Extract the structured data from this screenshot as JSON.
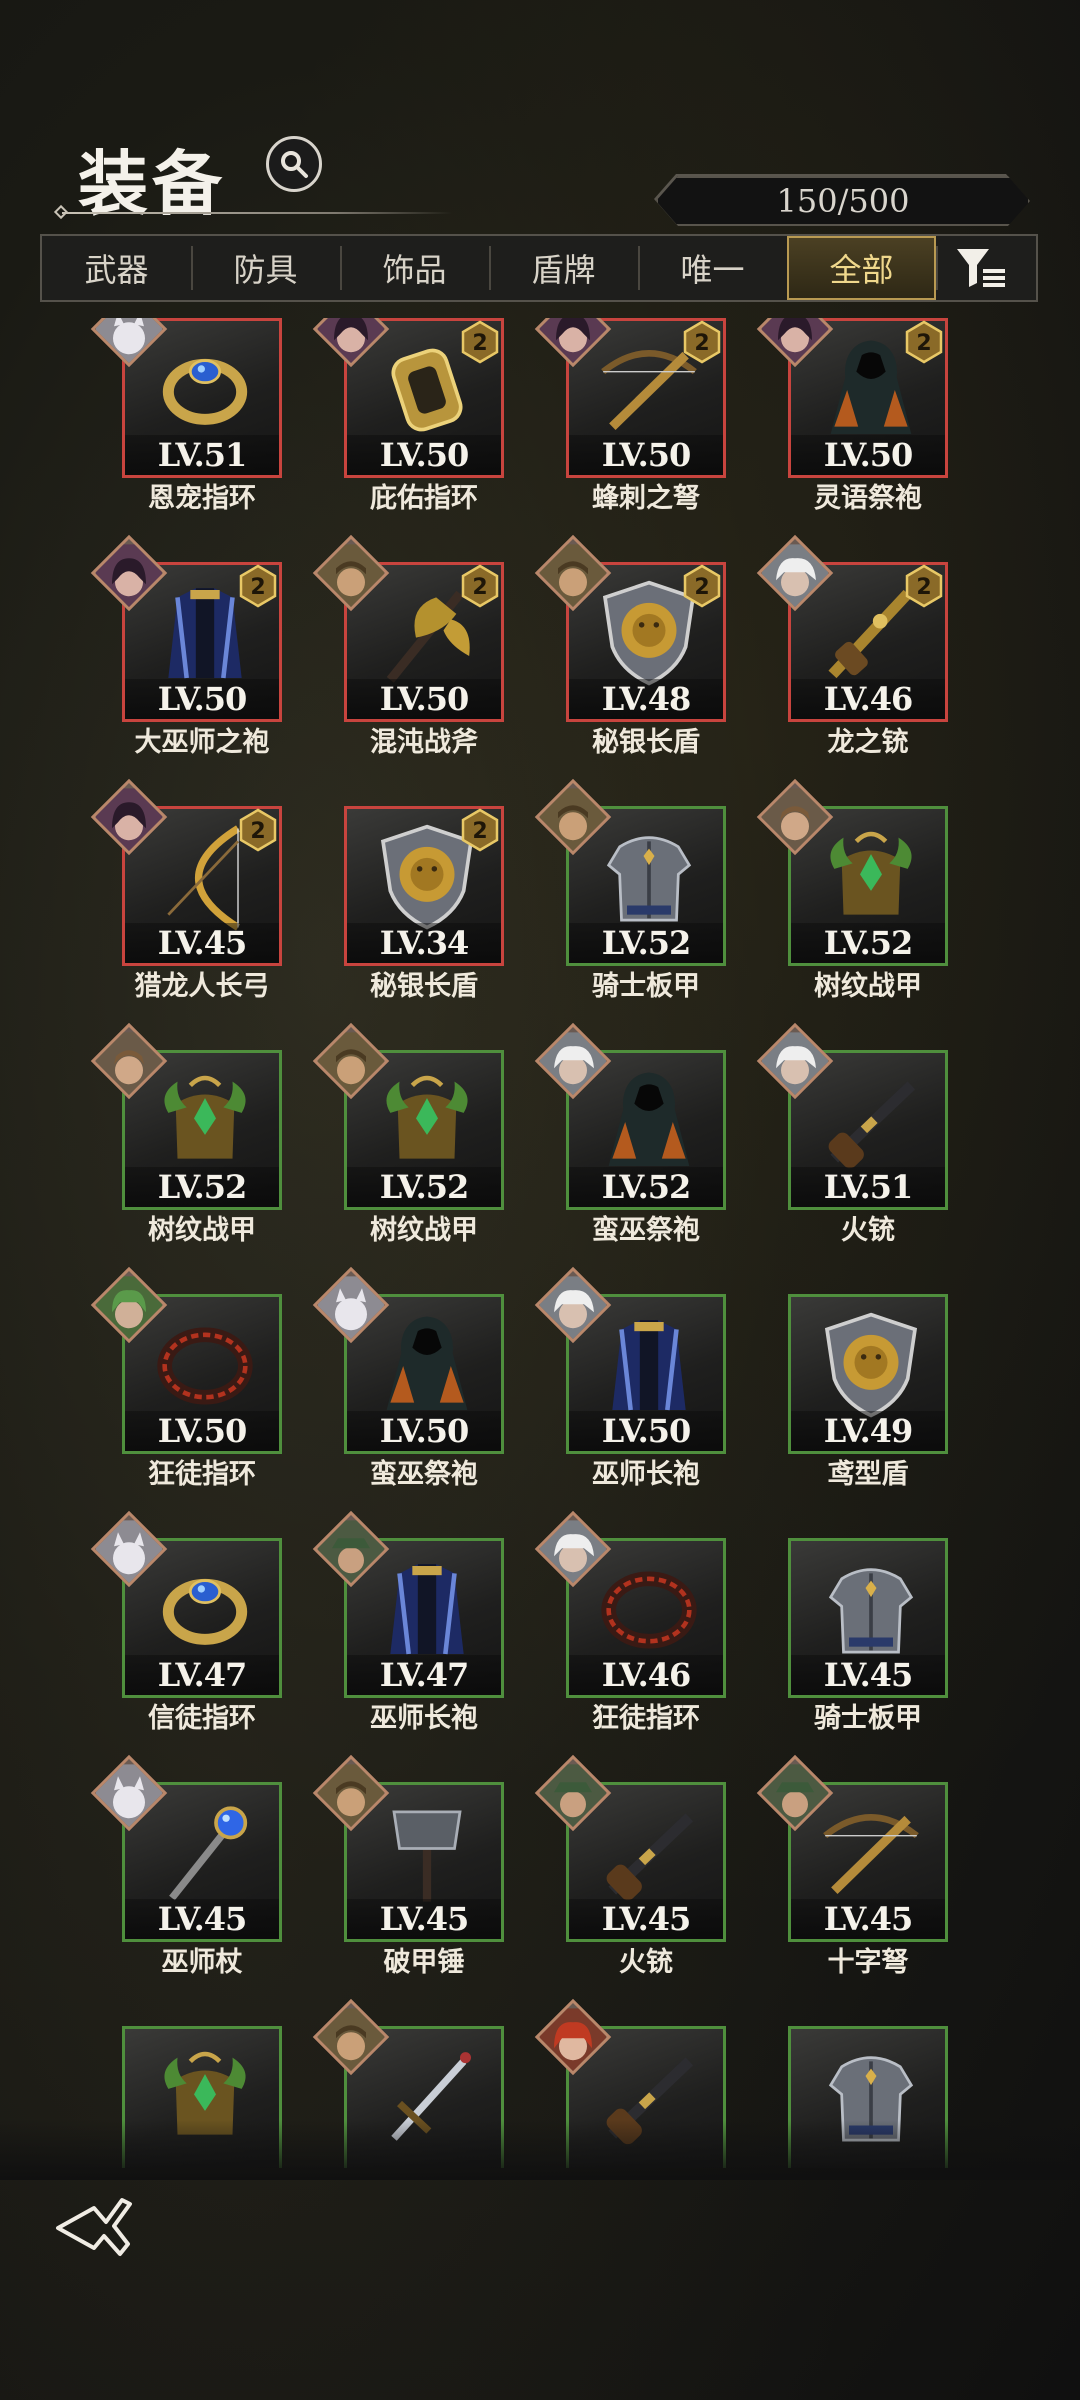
{
  "header": {
    "title": "装备",
    "counter": "150/500"
  },
  "tabs": [
    {
      "label": "武器"
    },
    {
      "label": "防具"
    },
    {
      "label": "饰品"
    },
    {
      "label": "盾牌"
    },
    {
      "label": "唯一"
    },
    {
      "label": "全部",
      "active": true
    }
  ],
  "colors": {
    "rare_border": "#c8443e",
    "uncommon_border": "#4f8f3d",
    "active_tab": "#b99a52"
  },
  "items": [
    {
      "name": "恩宠指环",
      "level": "LV.51",
      "rarity": "red",
      "icon": "ring-blue-gem-icon",
      "portrait": "white-cat-portrait"
    },
    {
      "name": "庇佑指环",
      "level": "LV.50",
      "rarity": "red",
      "icon": "gold-ring-icon",
      "badge": "2",
      "portrait": "dark-hair-woman-portrait"
    },
    {
      "name": "蜂刺之弩",
      "level": "LV.50",
      "rarity": "red",
      "icon": "crossbow-icon",
      "badge": "2",
      "portrait": "dark-hair-woman-portrait"
    },
    {
      "name": "灵语祭袍",
      "level": "LV.50",
      "rarity": "red",
      "icon": "hooded-robe-icon",
      "badge": "2",
      "portrait": "dark-hair-woman-portrait"
    },
    {
      "name": "大巫师之袍",
      "level": "LV.50",
      "rarity": "red",
      "icon": "blue-robe-icon",
      "badge": "2",
      "portrait": "dark-hair-woman-portrait"
    },
    {
      "name": "混沌战斧",
      "level": "LV.50",
      "rarity": "red",
      "icon": "battle-axe-icon",
      "badge": "2",
      "portrait": "warrior-portrait"
    },
    {
      "name": "秘银长盾",
      "level": "LV.48",
      "rarity": "red",
      "icon": "lion-shield-icon",
      "badge": "2",
      "portrait": "warrior-portrait"
    },
    {
      "name": "龙之铳",
      "level": "LV.46",
      "rarity": "red",
      "icon": "gold-gun-icon",
      "badge": "2",
      "portrait": "white-hair-portrait"
    },
    {
      "name": "猎龙人长弓",
      "level": "LV.45",
      "rarity": "red",
      "icon": "longbow-icon",
      "badge": "2",
      "portrait": "dark-hair-woman-portrait"
    },
    {
      "name": "秘银长盾",
      "level": "LV.34",
      "rarity": "red",
      "icon": "lion-shield-icon",
      "badge": "2",
      "portrait": null
    },
    {
      "name": "骑士板甲",
      "level": "LV.52",
      "rarity": "green",
      "icon": "plate-armor-icon",
      "portrait": "warrior-portrait"
    },
    {
      "name": "树纹战甲",
      "level": "LV.52",
      "rarity": "green",
      "icon": "leaf-armor-icon",
      "portrait": "elf-portrait"
    },
    {
      "name": "树纹战甲",
      "level": "LV.52",
      "rarity": "green",
      "icon": "leaf-armor-icon",
      "portrait": "elf-portrait"
    },
    {
      "name": "树纹战甲",
      "level": "LV.52",
      "rarity": "green",
      "icon": "leaf-armor-icon",
      "portrait": "warrior-portrait"
    },
    {
      "name": "蛮巫祭袍",
      "level": "LV.52",
      "rarity": "green",
      "icon": "hooded-robe-icon",
      "portrait": "white-hair-portrait"
    },
    {
      "name": "火铳",
      "level": "LV.51",
      "rarity": "green",
      "icon": "flintlock-icon",
      "portrait": "white-hair-portrait"
    },
    {
      "name": "狂徒指环",
      "level": "LV.50",
      "rarity": "green",
      "icon": "red-ring-icon",
      "portrait": "green-hair-portrait"
    },
    {
      "name": "蛮巫祭袍",
      "level": "LV.50",
      "rarity": "green",
      "icon": "hooded-robe-icon",
      "portrait": "white-cat-portrait"
    },
    {
      "name": "巫师长袍",
      "level": "LV.50",
      "rarity": "green",
      "icon": "blue-robe-icon",
      "portrait": "white-hair-portrait"
    },
    {
      "name": "鸢型盾",
      "level": "LV.49",
      "rarity": "green",
      "icon": "lion-shield-icon",
      "portrait": null
    },
    {
      "name": "信徒指环",
      "level": "LV.47",
      "rarity": "green",
      "icon": "ring-blue-gem-icon",
      "portrait": "white-cat-portrait"
    },
    {
      "name": "巫师长袍",
      "level": "LV.47",
      "rarity": "green",
      "icon": "blue-robe-icon",
      "portrait": "hat-man-portrait"
    },
    {
      "name": "狂徒指环",
      "level": "LV.46",
      "rarity": "green",
      "icon": "red-ring-icon",
      "portrait": "white-hair-portrait"
    },
    {
      "name": "骑士板甲",
      "level": "LV.45",
      "rarity": "green",
      "icon": "plate-armor-icon",
      "portrait": null
    },
    {
      "name": "巫师杖",
      "level": "LV.45",
      "rarity": "green",
      "icon": "blue-orb-staff-icon",
      "portrait": "white-cat-portrait"
    },
    {
      "name": "破甲锤",
      "level": "LV.45",
      "rarity": "green",
      "icon": "war-hammer-icon",
      "portrait": "warrior-portrait"
    },
    {
      "name": "火铳",
      "level": "LV.45",
      "rarity": "green",
      "icon": "flintlock-icon",
      "portrait": "hat-man-portrait"
    },
    {
      "name": "十字弩",
      "level": "LV.45",
      "rarity": "green",
      "icon": "crossbow-icon",
      "portrait": "hat-man-portrait"
    },
    {
      "name": "",
      "level": "",
      "rarity": "green",
      "icon": "leaf-armor-icon",
      "portrait": null
    },
    {
      "name": "",
      "level": "",
      "rarity": "green",
      "icon": "sword-icon",
      "portrait": "warrior-portrait"
    },
    {
      "name": "",
      "level": "",
      "rarity": "green",
      "icon": "flintlock-icon",
      "portrait": "red-hair-portrait"
    },
    {
      "name": "",
      "level": "",
      "rarity": "green",
      "icon": "plate-armor-icon",
      "portrait": null
    }
  ]
}
